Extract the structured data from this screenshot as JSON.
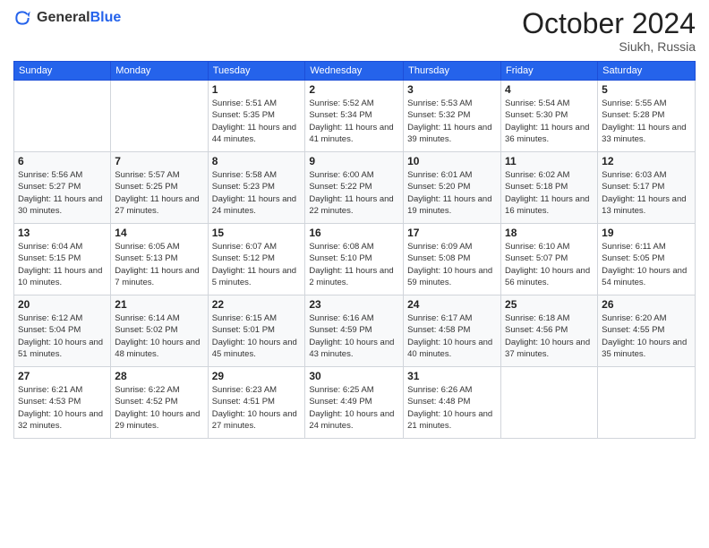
{
  "header": {
    "logo_general": "General",
    "logo_blue": "Blue",
    "month_title": "October 2024",
    "location": "Siukh, Russia"
  },
  "days_of_week": [
    "Sunday",
    "Monday",
    "Tuesday",
    "Wednesday",
    "Thursday",
    "Friday",
    "Saturday"
  ],
  "weeks": [
    [
      {
        "day": "",
        "info": ""
      },
      {
        "day": "",
        "info": ""
      },
      {
        "day": "1",
        "info": "Sunrise: 5:51 AM\nSunset: 5:35 PM\nDaylight: 11 hours and 44 minutes."
      },
      {
        "day": "2",
        "info": "Sunrise: 5:52 AM\nSunset: 5:34 PM\nDaylight: 11 hours and 41 minutes."
      },
      {
        "day": "3",
        "info": "Sunrise: 5:53 AM\nSunset: 5:32 PM\nDaylight: 11 hours and 39 minutes."
      },
      {
        "day": "4",
        "info": "Sunrise: 5:54 AM\nSunset: 5:30 PM\nDaylight: 11 hours and 36 minutes."
      },
      {
        "day": "5",
        "info": "Sunrise: 5:55 AM\nSunset: 5:28 PM\nDaylight: 11 hours and 33 minutes."
      }
    ],
    [
      {
        "day": "6",
        "info": "Sunrise: 5:56 AM\nSunset: 5:27 PM\nDaylight: 11 hours and 30 minutes."
      },
      {
        "day": "7",
        "info": "Sunrise: 5:57 AM\nSunset: 5:25 PM\nDaylight: 11 hours and 27 minutes."
      },
      {
        "day": "8",
        "info": "Sunrise: 5:58 AM\nSunset: 5:23 PM\nDaylight: 11 hours and 24 minutes."
      },
      {
        "day": "9",
        "info": "Sunrise: 6:00 AM\nSunset: 5:22 PM\nDaylight: 11 hours and 22 minutes."
      },
      {
        "day": "10",
        "info": "Sunrise: 6:01 AM\nSunset: 5:20 PM\nDaylight: 11 hours and 19 minutes."
      },
      {
        "day": "11",
        "info": "Sunrise: 6:02 AM\nSunset: 5:18 PM\nDaylight: 11 hours and 16 minutes."
      },
      {
        "day": "12",
        "info": "Sunrise: 6:03 AM\nSunset: 5:17 PM\nDaylight: 11 hours and 13 minutes."
      }
    ],
    [
      {
        "day": "13",
        "info": "Sunrise: 6:04 AM\nSunset: 5:15 PM\nDaylight: 11 hours and 10 minutes."
      },
      {
        "day": "14",
        "info": "Sunrise: 6:05 AM\nSunset: 5:13 PM\nDaylight: 11 hours and 7 minutes."
      },
      {
        "day": "15",
        "info": "Sunrise: 6:07 AM\nSunset: 5:12 PM\nDaylight: 11 hours and 5 minutes."
      },
      {
        "day": "16",
        "info": "Sunrise: 6:08 AM\nSunset: 5:10 PM\nDaylight: 11 hours and 2 minutes."
      },
      {
        "day": "17",
        "info": "Sunrise: 6:09 AM\nSunset: 5:08 PM\nDaylight: 10 hours and 59 minutes."
      },
      {
        "day": "18",
        "info": "Sunrise: 6:10 AM\nSunset: 5:07 PM\nDaylight: 10 hours and 56 minutes."
      },
      {
        "day": "19",
        "info": "Sunrise: 6:11 AM\nSunset: 5:05 PM\nDaylight: 10 hours and 54 minutes."
      }
    ],
    [
      {
        "day": "20",
        "info": "Sunrise: 6:12 AM\nSunset: 5:04 PM\nDaylight: 10 hours and 51 minutes."
      },
      {
        "day": "21",
        "info": "Sunrise: 6:14 AM\nSunset: 5:02 PM\nDaylight: 10 hours and 48 minutes."
      },
      {
        "day": "22",
        "info": "Sunrise: 6:15 AM\nSunset: 5:01 PM\nDaylight: 10 hours and 45 minutes."
      },
      {
        "day": "23",
        "info": "Sunrise: 6:16 AM\nSunset: 4:59 PM\nDaylight: 10 hours and 43 minutes."
      },
      {
        "day": "24",
        "info": "Sunrise: 6:17 AM\nSunset: 4:58 PM\nDaylight: 10 hours and 40 minutes."
      },
      {
        "day": "25",
        "info": "Sunrise: 6:18 AM\nSunset: 4:56 PM\nDaylight: 10 hours and 37 minutes."
      },
      {
        "day": "26",
        "info": "Sunrise: 6:20 AM\nSunset: 4:55 PM\nDaylight: 10 hours and 35 minutes."
      }
    ],
    [
      {
        "day": "27",
        "info": "Sunrise: 6:21 AM\nSunset: 4:53 PM\nDaylight: 10 hours and 32 minutes."
      },
      {
        "day": "28",
        "info": "Sunrise: 6:22 AM\nSunset: 4:52 PM\nDaylight: 10 hours and 29 minutes."
      },
      {
        "day": "29",
        "info": "Sunrise: 6:23 AM\nSunset: 4:51 PM\nDaylight: 10 hours and 27 minutes."
      },
      {
        "day": "30",
        "info": "Sunrise: 6:25 AM\nSunset: 4:49 PM\nDaylight: 10 hours and 24 minutes."
      },
      {
        "day": "31",
        "info": "Sunrise: 6:26 AM\nSunset: 4:48 PM\nDaylight: 10 hours and 21 minutes."
      },
      {
        "day": "",
        "info": ""
      },
      {
        "day": "",
        "info": ""
      }
    ]
  ]
}
